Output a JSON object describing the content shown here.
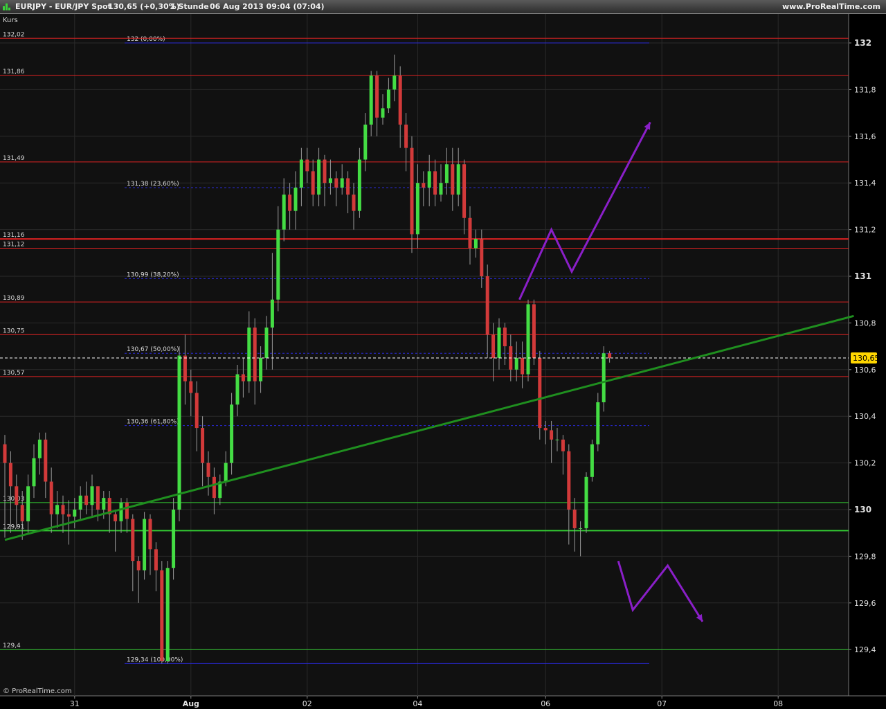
{
  "window": {
    "symbol": "EURJPY - EUR/JPY Spot",
    "last_quote": "130,65 (+0,30%)",
    "timeframe": "1 Stunde",
    "datetime": "06 Aug 2013 09:04 (07:04)",
    "site": "www.ProRealTime.com"
  },
  "panel_label": "Kurs",
  "copyright": "© ProRealTime.com",
  "colors": {
    "background": "#111111",
    "candle_up": "#44dd44",
    "candle_down": "#d23a3a",
    "resistance": "#dd2222",
    "support": "#33cc33",
    "fibonacci": "#2a2ad8",
    "trendline": "#1f8f1f",
    "projection": "#8a1fc8",
    "price_tag": "#ffd600"
  },
  "chart_data": {
    "type": "candlestick",
    "y_axis": {
      "ylim": [
        129.05,
        132.2
      ],
      "ticks": [
        132,
        131.8,
        131.6,
        131.4,
        131.2,
        131,
        130.8,
        130.6,
        130.4,
        130.2,
        130,
        129.8,
        129.6,
        129.4
      ],
      "tick_labels": [
        "132",
        "131,8",
        "131,6",
        "131,4",
        "131,2",
        "131",
        "130,8",
        "130,6",
        "130,4",
        "130,2",
        "130",
        "129,8",
        "129,6",
        "129,4"
      ],
      "bold_ticks": [
        "132",
        "131",
        "130"
      ],
      "current_price": "130,65"
    },
    "x_axis": {
      "labels": [
        "31",
        "Aug",
        "02",
        "04",
        "06",
        "07",
        "08"
      ],
      "bold_labels": [
        "Aug"
      ],
      "grid": true
    },
    "horizontal_levels": [
      {
        "label": "132,02",
        "value": 132.02,
        "kind": "resistance"
      },
      {
        "label": "131,86",
        "value": 131.86,
        "kind": "resistance"
      },
      {
        "label": "131,49",
        "value": 131.49,
        "kind": "resistance"
      },
      {
        "label": "131,16",
        "value": 131.16,
        "kind": "resistance",
        "thick": true
      },
      {
        "label": "131,12",
        "value": 131.12,
        "kind": "resistance"
      },
      {
        "label": "130,89",
        "value": 130.89,
        "kind": "resistance"
      },
      {
        "label": "130,75",
        "value": 130.75,
        "kind": "resistance"
      },
      {
        "label": "130,57",
        "value": 130.57,
        "kind": "resistance"
      },
      {
        "label": "130,03",
        "value": 130.03,
        "kind": "support"
      },
      {
        "label": "129,91",
        "value": 129.91,
        "kind": "support",
        "thick": true
      },
      {
        "label": "129,4",
        "value": 129.4,
        "kind": "support"
      }
    ],
    "fibonacci_levels": [
      {
        "label": "132 (0,00%)",
        "value": 132.0
      },
      {
        "label": "131,38 (23,60%)",
        "value": 131.38
      },
      {
        "label": "130,99 (38,20%)",
        "value": 130.99
      },
      {
        "label": "130,67 (50,00%)",
        "value": 130.67
      },
      {
        "label": "130,36 (61,80%)",
        "value": 130.36
      },
      {
        "label": "129,34 (100,00%)",
        "value": 129.34
      }
    ],
    "trendline": {
      "start": [
        0,
        129.87
      ],
      "end": [
        146,
        130.83
      ]
    },
    "projections": [
      {
        "name": "bullish",
        "points": [
          [
            88.5,
            130.9
          ],
          [
            94,
            131.2
          ],
          [
            97.5,
            131.02
          ],
          [
            111,
            131.66
          ]
        ]
      },
      {
        "name": "bearish",
        "points": [
          [
            105.5,
            129.78
          ],
          [
            108,
            129.57
          ],
          [
            114,
            129.76
          ],
          [
            120,
            129.52
          ]
        ]
      }
    ],
    "x_label_positions": [
      12,
      32,
      52,
      71,
      93,
      113,
      133
    ],
    "candles": [
      [
        130.28,
        130.2,
        129.88,
        130.32
      ],
      [
        130.2,
        130.1,
        129.9,
        130.25
      ],
      [
        130.1,
        130.02,
        129.92,
        130.15
      ],
      [
        130.02,
        129.95,
        129.87,
        130.08
      ],
      [
        129.95,
        130.1,
        129.9,
        130.15
      ],
      [
        130.1,
        130.22,
        130.05,
        130.28
      ],
      [
        130.22,
        130.3,
        130.15,
        130.33
      ],
      [
        130.3,
        130.12,
        130.05,
        130.33
      ],
      [
        130.12,
        129.98,
        129.9,
        130.18
      ],
      [
        129.98,
        130.02,
        129.92,
        130.08
      ],
      [
        130.02,
        129.98,
        129.9,
        130.06
      ],
      [
        129.98,
        129.97,
        129.85,
        130.04
      ],
      [
        129.97,
        130.0,
        129.92,
        130.05
      ],
      [
        130.0,
        130.06,
        129.96,
        130.1
      ],
      [
        130.06,
        130.02,
        129.98,
        130.12
      ],
      [
        130.02,
        130.1,
        129.97,
        130.15
      ],
      [
        130.1,
        130.0,
        129.95,
        130.1
      ],
      [
        130.0,
        130.05,
        129.96,
        130.08
      ],
      [
        130.05,
        129.98,
        129.9,
        130.08
      ],
      [
        129.98,
        129.95,
        129.82,
        130.0
      ],
      [
        129.95,
        130.03,
        129.9,
        130.05
      ],
      [
        130.03,
        129.96,
        129.9,
        130.05
      ],
      [
        129.96,
        129.78,
        129.65,
        129.98
      ],
      [
        129.78,
        129.74,
        129.6,
        129.8
      ],
      [
        129.74,
        129.96,
        129.7,
        129.99
      ],
      [
        129.96,
        129.83,
        129.72,
        129.98
      ],
      [
        129.83,
        129.74,
        129.65,
        129.86
      ],
      [
        129.74,
        129.35,
        129.34,
        129.78
      ],
      [
        129.35,
        129.75,
        129.34,
        129.78
      ],
      [
        129.75,
        130.0,
        129.7,
        130.05
      ],
      [
        130.0,
        130.66,
        129.95,
        130.7
      ],
      [
        130.66,
        130.55,
        130.45,
        130.75
      ],
      [
        130.55,
        130.5,
        130.4,
        130.6
      ],
      [
        130.5,
        130.35,
        130.25,
        130.55
      ],
      [
        130.35,
        130.2,
        130.1,
        130.4
      ],
      [
        130.2,
        130.14,
        130.06,
        130.25
      ],
      [
        130.14,
        130.05,
        129.98,
        130.18
      ],
      [
        130.05,
        130.12,
        130.02,
        130.15
      ],
      [
        130.12,
        130.2,
        130.1,
        130.25
      ],
      [
        130.2,
        130.45,
        130.15,
        130.5
      ],
      [
        130.45,
        130.58,
        130.4,
        130.62
      ],
      [
        130.58,
        130.55,
        130.48,
        130.65
      ],
      [
        130.55,
        130.78,
        130.5,
        130.85
      ],
      [
        130.78,
        130.55,
        130.45,
        130.82
      ],
      [
        130.55,
        130.65,
        130.5,
        130.7
      ],
      [
        130.65,
        130.78,
        130.6,
        130.83
      ],
      [
        130.78,
        130.9,
        130.6,
        131.1
      ],
      [
        130.9,
        131.2,
        130.85,
        131.3
      ],
      [
        131.2,
        131.35,
        131.15,
        131.42
      ],
      [
        131.35,
        131.28,
        131.2,
        131.4
      ],
      [
        131.28,
        131.38,
        131.2,
        131.45
      ],
      [
        131.38,
        131.5,
        131.3,
        131.55
      ],
      [
        131.5,
        131.45,
        131.4,
        131.55
      ],
      [
        131.45,
        131.35,
        131.3,
        131.5
      ],
      [
        131.35,
        131.5,
        131.3,
        131.55
      ],
      [
        131.5,
        131.4,
        131.3,
        131.52
      ],
      [
        131.4,
        131.42,
        131.35,
        131.5
      ],
      [
        131.42,
        131.38,
        131.3,
        131.45
      ],
      [
        131.38,
        131.42,
        131.35,
        131.48
      ],
      [
        131.42,
        131.35,
        131.27,
        131.45
      ],
      [
        131.35,
        131.28,
        131.2,
        131.4
      ],
      [
        131.28,
        131.5,
        131.25,
        131.55
      ],
      [
        131.5,
        131.65,
        131.45,
        131.7
      ],
      [
        131.65,
        131.86,
        131.6,
        131.88
      ],
      [
        131.86,
        131.68,
        131.6,
        131.88
      ],
      [
        131.68,
        131.72,
        131.65,
        131.78
      ],
      [
        131.72,
        131.8,
        131.7,
        131.85
      ],
      [
        131.8,
        131.86,
        131.75,
        131.95
      ],
      [
        131.86,
        131.65,
        131.55,
        131.9
      ],
      [
        131.65,
        131.55,
        131.45,
        131.7
      ],
      [
        131.55,
        131.18,
        131.1,
        131.6
      ],
      [
        131.18,
        131.4,
        131.12,
        131.48
      ],
      [
        131.4,
        131.38,
        131.3,
        131.45
      ],
      [
        131.38,
        131.45,
        131.3,
        131.52
      ],
      [
        131.45,
        131.35,
        131.3,
        131.5
      ],
      [
        131.35,
        131.4,
        131.32,
        131.48
      ],
      [
        131.4,
        131.48,
        131.35,
        131.55
      ],
      [
        131.48,
        131.35,
        131.28,
        131.55
      ],
      [
        131.35,
        131.48,
        131.3,
        131.55
      ],
      [
        131.48,
        131.25,
        131.18,
        131.5
      ],
      [
        131.25,
        131.12,
        131.05,
        131.3
      ],
      [
        131.12,
        131.16,
        131.08,
        131.2
      ],
      [
        131.16,
        131.0,
        130.95,
        131.2
      ],
      [
        131.0,
        130.75,
        130.65,
        131.05
      ],
      [
        130.75,
        130.65,
        130.55,
        130.8
      ],
      [
        130.65,
        130.78,
        130.6,
        130.82
      ],
      [
        130.78,
        130.7,
        130.62,
        130.8
      ],
      [
        130.7,
        130.6,
        130.55,
        130.75
      ],
      [
        130.6,
        130.65,
        130.55,
        130.72
      ],
      [
        130.65,
        130.58,
        130.52,
        130.72
      ],
      [
        130.58,
        130.88,
        130.55,
        130.9
      ],
      [
        130.88,
        130.65,
        130.62,
        130.9
      ],
      [
        130.65,
        130.35,
        130.3,
        130.68
      ],
      [
        130.35,
        130.34,
        130.28,
        130.38
      ],
      [
        130.34,
        130.3,
        130.2,
        130.38
      ],
      [
        130.3,
        130.3,
        130.25,
        130.35
      ],
      [
        130.3,
        130.25,
        130.15,
        130.32
      ],
      [
        130.25,
        130.0,
        129.85,
        130.28
      ],
      [
        130.0,
        129.92,
        129.82,
        130.05
      ],
      [
        129.92,
        129.92,
        129.8,
        129.95
      ],
      [
        129.92,
        130.14,
        129.9,
        130.16
      ],
      [
        130.14,
        130.28,
        130.12,
        130.3
      ],
      [
        130.28,
        130.46,
        130.25,
        130.5
      ],
      [
        130.46,
        130.67,
        130.42,
        130.7
      ],
      [
        130.67,
        130.65,
        130.63,
        130.68
      ]
    ]
  }
}
